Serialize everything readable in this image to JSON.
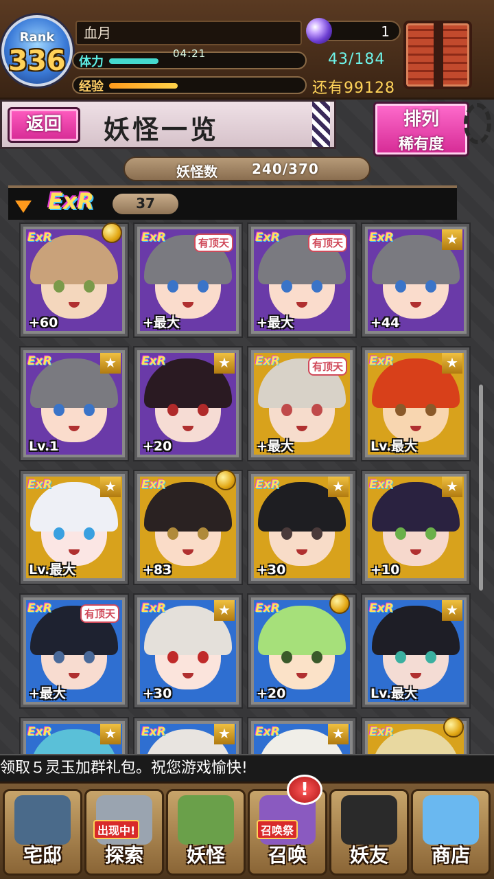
{
  "header": {
    "rank_label": "Rank",
    "rank_value": "336",
    "player_name": "血月",
    "stamina_label": "体力",
    "stamina_timer": "04:21",
    "stamina_count": "43/184",
    "exp_label": "经验",
    "exp_remaining": "还有99128",
    "gem_count": "1"
  },
  "title_bar": {
    "back_label": "返回",
    "page_title": "妖怪一览",
    "sort_title": "排列",
    "sort_subtitle": "稀有度"
  },
  "count_bar": {
    "label": "妖怪数",
    "value": "240/370"
  },
  "rarity_section": {
    "rarity": "ExR",
    "count": "37"
  },
  "cards": [
    {
      "level": "+60",
      "frame": "purple",
      "badge": "medal",
      "hair": "#c9a27a",
      "skin": "#f4d7bd",
      "eyes": "#7a9a4a"
    },
    {
      "level": "+最大",
      "frame": "purple",
      "badge": "tag",
      "tag": "有顶天",
      "hair": "#7a7a80",
      "skin": "#fadccc",
      "eyes": "#3a74c8"
    },
    {
      "level": "+最大",
      "frame": "purple",
      "badge": "tag",
      "tag": "有顶天",
      "hair": "#7a7a80",
      "skin": "#fadccc",
      "eyes": "#3a74c8"
    },
    {
      "level": "+44",
      "frame": "purple",
      "badge": "star",
      "hair": "#7a7a80",
      "skin": "#fadccc",
      "eyes": "#3a74c8"
    },
    {
      "level": "Lv.1",
      "frame": "purple",
      "badge": "star",
      "hair": "#7a7a80",
      "skin": "#fadccc",
      "eyes": "#3a74c8"
    },
    {
      "level": "+20",
      "frame": "purple",
      "badge": "star",
      "hair": "#2a1a22",
      "skin": "#f6dcd4",
      "eyes": "#b02a2a"
    },
    {
      "level": "+最大",
      "frame": "gold",
      "badge": "tag",
      "tag": "有顶天",
      "hair": "#d8d2c8",
      "skin": "#f6dccc",
      "eyes": "#c04a4a"
    },
    {
      "level": "Lv.最大",
      "frame": "gold",
      "badge": "star",
      "hair": "#d8401a",
      "skin": "#f8d6b0",
      "eyes": "#8a5a2a"
    },
    {
      "level": "Lv.最大",
      "frame": "gold",
      "badge": "star",
      "hair": "#eef0f6",
      "skin": "#fbe6e4",
      "eyes": "#3aa0e0"
    },
    {
      "level": "+83",
      "frame": "gold",
      "badge": "medal",
      "hair": "#2a2222",
      "skin": "#fadcc8",
      "eyes": "#b08a3a"
    },
    {
      "level": "+30",
      "frame": "gold",
      "badge": "star",
      "hair": "#1e1e22",
      "skin": "#f8dcc8",
      "eyes": "#4a3a3a"
    },
    {
      "level": "+10",
      "frame": "gold",
      "badge": "star",
      "hair": "#2a2240",
      "skin": "#f6d8cc",
      "eyes": "#6ab04a"
    },
    {
      "level": "+最大",
      "frame": "blue",
      "badge": "tag",
      "tag": "有顶天",
      "hair": "#1e2230",
      "skin": "#f8dcd0",
      "eyes": "#4a6a9a"
    },
    {
      "level": "+30",
      "frame": "blue",
      "badge": "star",
      "hair": "#e4e0da",
      "skin": "#fbe4dc",
      "eyes": "#c02a2a"
    },
    {
      "level": "+20",
      "frame": "blue",
      "badge": "medal",
      "hair": "#a6e07a",
      "skin": "#fbe2c8",
      "eyes": "#3a5a2a"
    },
    {
      "level": "Lv.最大",
      "frame": "blue",
      "badge": "star",
      "hair": "#1e1e26",
      "skin": "#f4dcd4",
      "eyes": "#3ab0a0"
    },
    {
      "level": "",
      "frame": "blue",
      "badge": "star",
      "hair": "#5ac0d8",
      "skin": "#fbe2d4",
      "eyes": "#3a74c8"
    },
    {
      "level": "",
      "frame": "blue",
      "badge": "star",
      "hair": "#e8e4e0",
      "skin": "#fbe4dc",
      "eyes": "#c02a2a"
    },
    {
      "level": "",
      "frame": "blue",
      "badge": "star",
      "hair": "#f0eee8",
      "skin": "#fbe4dc",
      "eyes": "#3a74c8"
    },
    {
      "level": "",
      "frame": "gold",
      "badge": "medal",
      "hair": "#e8d8a0",
      "skin": "#fbe4d0",
      "eyes": "#8a6a3a"
    }
  ],
  "notice": "领取５灵玉加群礼包。祝您游戏愉快!",
  "nav": [
    {
      "label": "宅邸",
      "icon": "mansion-icon",
      "color": "#4a6a8a"
    },
    {
      "label": "探索",
      "icon": "explore-icon",
      "color": "#9aa4b0",
      "badge": "出现中!"
    },
    {
      "label": "妖怪",
      "icon": "youkai-scroll-icon",
      "color": "#6aa04a"
    },
    {
      "label": "召唤",
      "icon": "summon-icon",
      "color": "#8a5ac0",
      "badge": "召唤祭"
    },
    {
      "label": "妖友",
      "icon": "friend-icon",
      "color": "#2a2a2a"
    },
    {
      "label": "商店",
      "icon": "shop-orb-icon",
      "color": "#6ab8f0"
    }
  ],
  "alert": "!"
}
